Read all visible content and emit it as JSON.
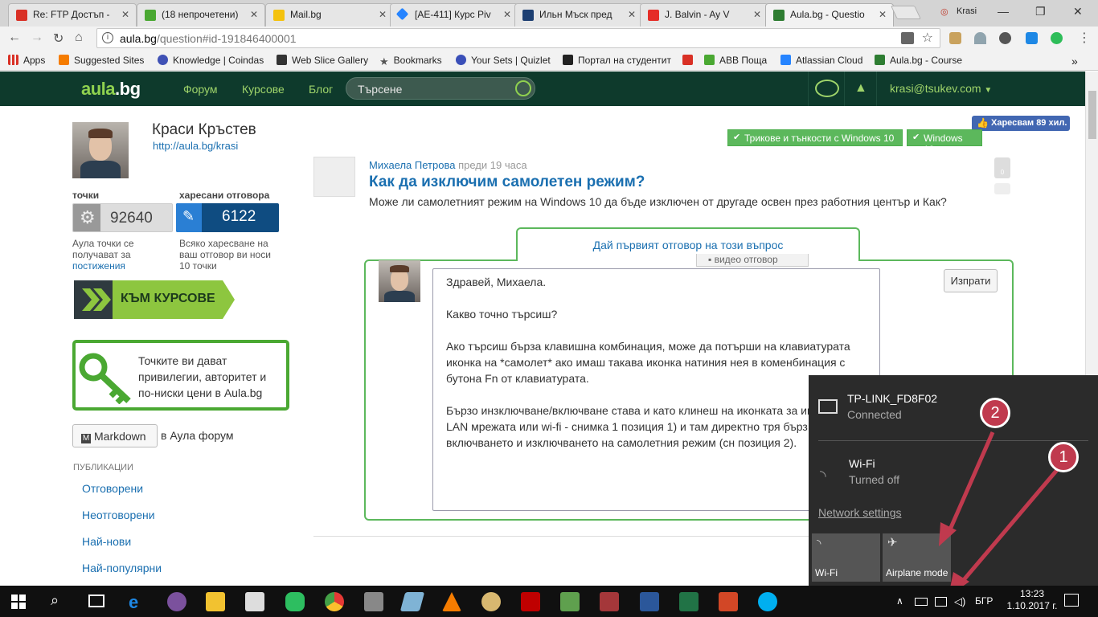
{
  "tabs": [
    {
      "label": "Re: FTP Достъп - ",
      "color": "#d93025",
      "icon": "gmail-icon"
    },
    {
      "label": "(18 непрочетени)",
      "color": "#4aa832",
      "icon": "abv-house-icon"
    },
    {
      "label": "Mail.bg",
      "color": "#f4c20d",
      "icon": "mailbg-icon"
    },
    {
      "label": "[AE-411] Курс Piv",
      "color": "#2684ff",
      "icon": "jira-icon"
    },
    {
      "label": "Ильн Мъск пред",
      "color": "#1d3f72",
      "icon": "k-icon"
    },
    {
      "label": "J. Balvin - Ay V",
      "color": "#e52d27",
      "icon": "youtube-icon"
    },
    {
      "label": "Aula.bg - Questio",
      "color": "#2e7d32",
      "icon": "aula-icon"
    }
  ],
  "window": {
    "profile": "Krasi"
  },
  "toolbar": {
    "url_host": "aula.bg",
    "url_path": "/question#id-191846400001"
  },
  "bookmarks": [
    {
      "label": "Apps",
      "color": "#d93025"
    },
    {
      "label": "Suggested Sites",
      "color": "#f57c00"
    },
    {
      "label": "Knowledge | Coindas",
      "color": "#3f51b5"
    },
    {
      "label": "Web Slice Gallery",
      "color": "#333"
    },
    {
      "label": "Bookmarks",
      "color": "#555"
    },
    {
      "label": "Your Sets | Quizlet",
      "color": "#3a4fb8"
    },
    {
      "label": "Портал на студентит",
      "color": "#222"
    },
    {
      "label": "",
      "color": "#d93025"
    },
    {
      "label": "ABB Поща",
      "color": "#4aa832"
    },
    {
      "label": "Atlassian Cloud",
      "color": "#2684ff"
    },
    {
      "label": "Aula.bg - Course",
      "color": "#2e7d32"
    }
  ],
  "site": {
    "logo_a": "aula",
    "logo_b": ".bg",
    "nav": [
      "Форум",
      "Курсове",
      "Блог"
    ],
    "search_placeholder": "Търсене",
    "user": "krasi@tsukev.com"
  },
  "profile": {
    "name": "Краси Кръстев",
    "link": "http://aula.bg/krasi",
    "points_label": "точки",
    "points": "92640",
    "points_desc": "Аула точки се получават за",
    "points_desc_link": "постижения",
    "likes_label": "харесани отговора",
    "likes": "6122",
    "likes_desc": "Всяко харесване на ваш отговор ви носи 10 точки",
    "courses_btn": "КЪМ КУРСОВЕ",
    "privileges": "Точките ви дават привилегии, авторитет и по-ниски цени в Aula.bg",
    "markdown_btn": "Markdown",
    "markdown_tail": "в Аула форум",
    "pub_heading": "ПУБЛИКАЦИИ",
    "pub_links": [
      "Отговорени",
      "Неотговорени",
      "Най-нови",
      "Най-популярни"
    ]
  },
  "question": {
    "tags": [
      "Трикове и тънкости с Windows 10",
      "Windows 10"
    ],
    "fb_like": "Харесвам 89 хил.",
    "author": "Михаела Петрова",
    "time": "преди 19 часа",
    "title": "Как да изключим самолетен режим?",
    "body": "Може ли самолетният режим на Windows 10 да бъде изключен от другаде освен през работния център и Как?",
    "votes": "0"
  },
  "answer": {
    "tab_label": "Дай първият отговор на този въпрос",
    "video_tab": "видео отговор",
    "send": "Изпрати",
    "lines": [
      "Здравей, Михаела.",
      "Какво точно търсиш?",
      "Ако търсиш бърза клавишна комбинация, може да потърши на клавиатурата иконка на *самолет* ако имаш такава иконка натиния нея в коменбинация с бутона Fn от клавиатурата.",
      "Бързо инзключване/включване става и като клинеш на иконката за ин (било LAN мрежата или wi-fi - снимка 1 позиция 1) и там директно тря бърз бутон за включването и изключването на самолетния режим (сн позиция 2)."
    ]
  },
  "network": {
    "conn_name": "TP-LINK_FD8F02",
    "conn_status": "Connected",
    "wifi_name": "Wi-Fi",
    "wifi_status": "Turned off",
    "settings": "Network settings",
    "tile_wifi": "Wi-Fi",
    "tile_airplane": "Airplane mode",
    "callout1": "1",
    "callout2": "2"
  },
  "taskbar": {
    "lang": "БГР",
    "time": "13:23",
    "date": "1.10.2017 г.",
    "apps": [
      {
        "name": "cortana-icon",
        "color": "transparent"
      },
      {
        "name": "task-view-icon",
        "color": "transparent"
      },
      {
        "name": "edge-icon",
        "color": "#1e88e5"
      },
      {
        "name": "viber-icon",
        "color": "#7b519d"
      },
      {
        "name": "file-explorer-icon",
        "color": "#f2c230"
      },
      {
        "name": "store-icon",
        "color": "#ddd"
      },
      {
        "name": "evernote-icon",
        "color": "#2dbe60"
      },
      {
        "name": "chrome-icon",
        "color": "#e53935"
      },
      {
        "name": "calculator-icon",
        "color": "#888"
      },
      {
        "name": "notepad-icon",
        "color": "#7fb3d5"
      },
      {
        "name": "vlc-icon",
        "color": "#f57c00"
      },
      {
        "name": "paint-icon",
        "color": "#d8b870"
      },
      {
        "name": "filezilla-icon",
        "color": "#bf0000"
      },
      {
        "name": "chart-app-icon",
        "color": "#5fa04e"
      },
      {
        "name": "access-icon",
        "color": "#a4373a"
      },
      {
        "name": "word-icon",
        "color": "#2b579a"
      },
      {
        "name": "excel-icon",
        "color": "#217346"
      },
      {
        "name": "powerpoint-icon",
        "color": "#d24726"
      },
      {
        "name": "skype-icon",
        "color": "#00aff0"
      }
    ]
  }
}
